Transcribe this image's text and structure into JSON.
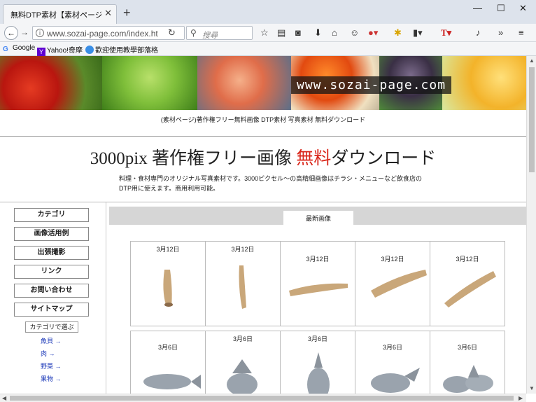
{
  "browser": {
    "tab_title": "無料DTP素材【素材ページ…",
    "tab_close": "✕",
    "new_tab": "+",
    "url": "www.sozai-page.com/index.ht",
    "search_placeholder": "搜尋",
    "bookmarks": [
      "Google",
      "Yahoo!奇摩",
      "歡迎使用教學部落格"
    ]
  },
  "page": {
    "banner_text": "www.sozai-page.com",
    "subtitle": "(素材ページ)著作権フリー無料画像 DTP素材 写真素材 無料ダウンロード",
    "title_main": "3000pix 著作権フリー画像 ",
    "title_red": "無料",
    "title_tail": "ダウンロード",
    "description": "料理・食材専門のオリジナル写真素材です。3000ピクセル〜の高精細画像はチラシ・メニューなど飲食店のDTP用に使えます。商用利用可能。",
    "sidebar": {
      "buttons": [
        "カテゴリ",
        "画像活用例",
        "出張撮影",
        "リンク",
        "お問い合わせ",
        "サイトマップ"
      ],
      "category_label": "カテゴリで選ぶ",
      "category_links": [
        "魚貝 →",
        "肉 →",
        "野菜 →",
        "果物 →"
      ]
    },
    "content_tab": "最新画像",
    "row1_dates": [
      "3月12日",
      "3月12日",
      "3月12日",
      "3月12日",
      "3月12日"
    ],
    "row2_dates": [
      "3月6日",
      "3月6日",
      "3月6日",
      "3月6日",
      "3月6日"
    ]
  },
  "colors": {
    "accent_red": "#d9271b",
    "link_blue": "#1a37b8"
  }
}
